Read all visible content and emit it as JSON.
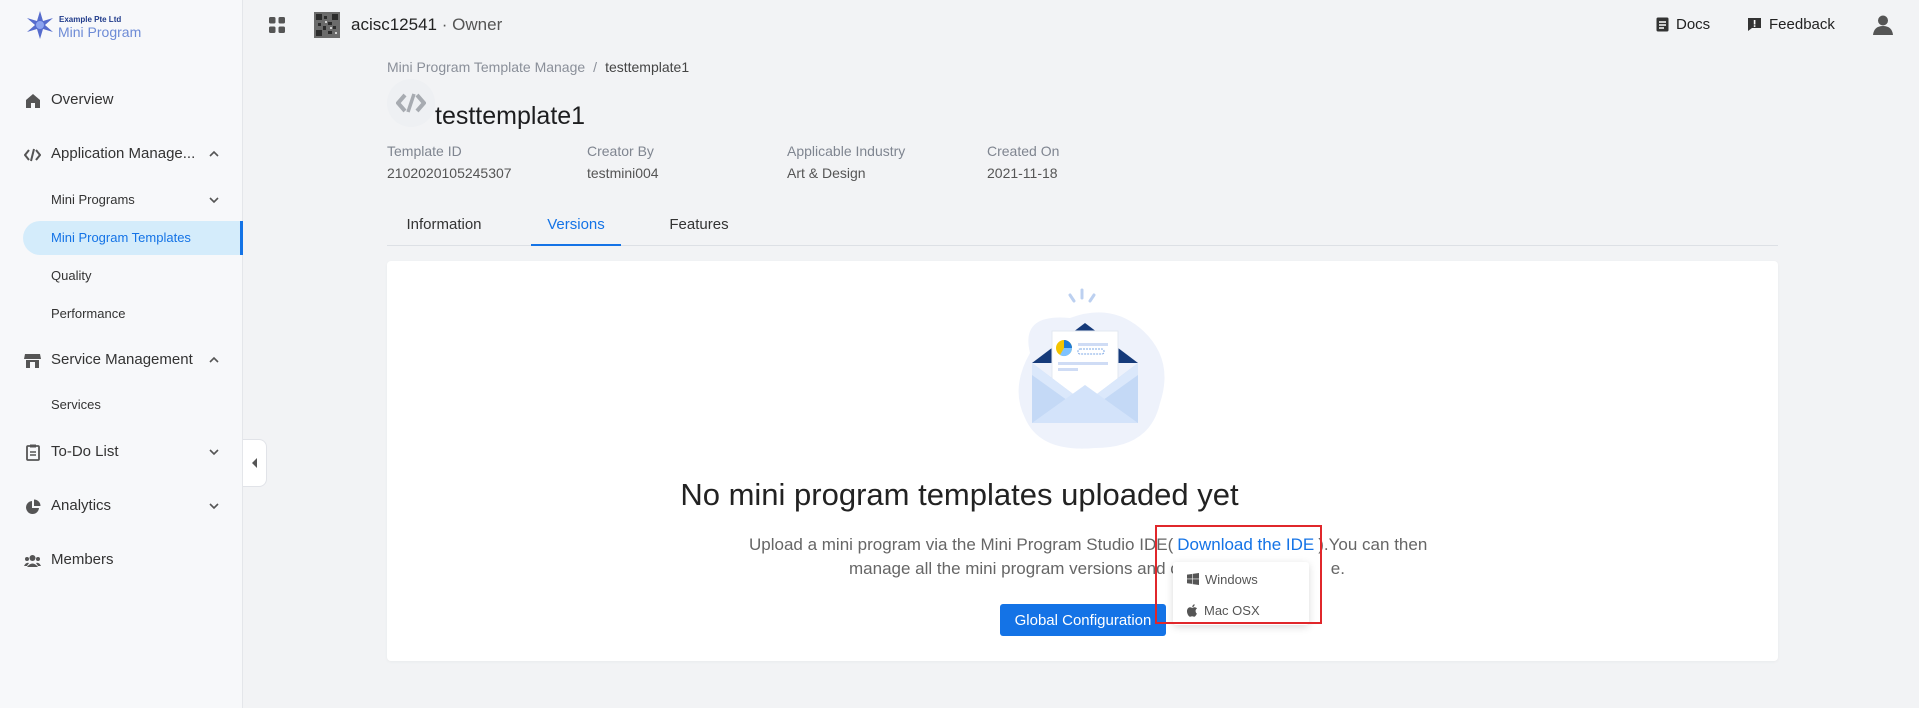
{
  "brand": {
    "company": "Example Pte Ltd",
    "product": "Mini Program"
  },
  "header": {
    "account": "acisc12541",
    "separator": "·",
    "role": "Owner",
    "docs": "Docs",
    "feedback": "Feedback"
  },
  "sidebar": {
    "overview": "Overview",
    "application_management": "Application Manage...",
    "mini_programs": "Mini Programs",
    "mini_program_templates": "Mini Program Templates",
    "quality": "Quality",
    "performance": "Performance",
    "service_management": "Service Management",
    "services": "Services",
    "todo_list": "To-Do List",
    "analytics": "Analytics",
    "members": "Members"
  },
  "breadcrumb": {
    "parent": "Mini Program Template Manage",
    "separator": "/",
    "current": "testtemplate1"
  },
  "template": {
    "title": "testtemplate1",
    "meta": [
      {
        "label": "Template ID",
        "value": "2102020105245307"
      },
      {
        "label": "Creator By",
        "value": "testmini004"
      },
      {
        "label": "Applicable Industry",
        "value": "Art & Design"
      },
      {
        "label": "Created On",
        "value": "2021-11-18"
      }
    ]
  },
  "tabs": [
    "Information",
    "Versions",
    "Features"
  ],
  "active_tab": "Versions",
  "empty_state": {
    "title": "No mini program templates uploaded yet",
    "desc_prefix": "Upload a mini program via the Mini Program Studio IDE(",
    "desc_link": "Download the IDE",
    "desc_suffix": ").You can then",
    "desc_line2": "manage all the mini program versions and c",
    "desc_line2_end": "e.",
    "button": "Global Configuration"
  },
  "download_menu": {
    "items": [
      "Windows",
      "Mac OSX"
    ]
  },
  "colors": {
    "primary": "#1473e6",
    "highlight": "#e0272b",
    "active_bg": "#d4ecfb"
  },
  "icons": {
    "overview": "home-icon",
    "application_management": "code-link-icon",
    "service_management": "store-icon",
    "todo_list": "clipboard-icon",
    "analytics": "pie-chart-icon",
    "members": "users-icon"
  }
}
